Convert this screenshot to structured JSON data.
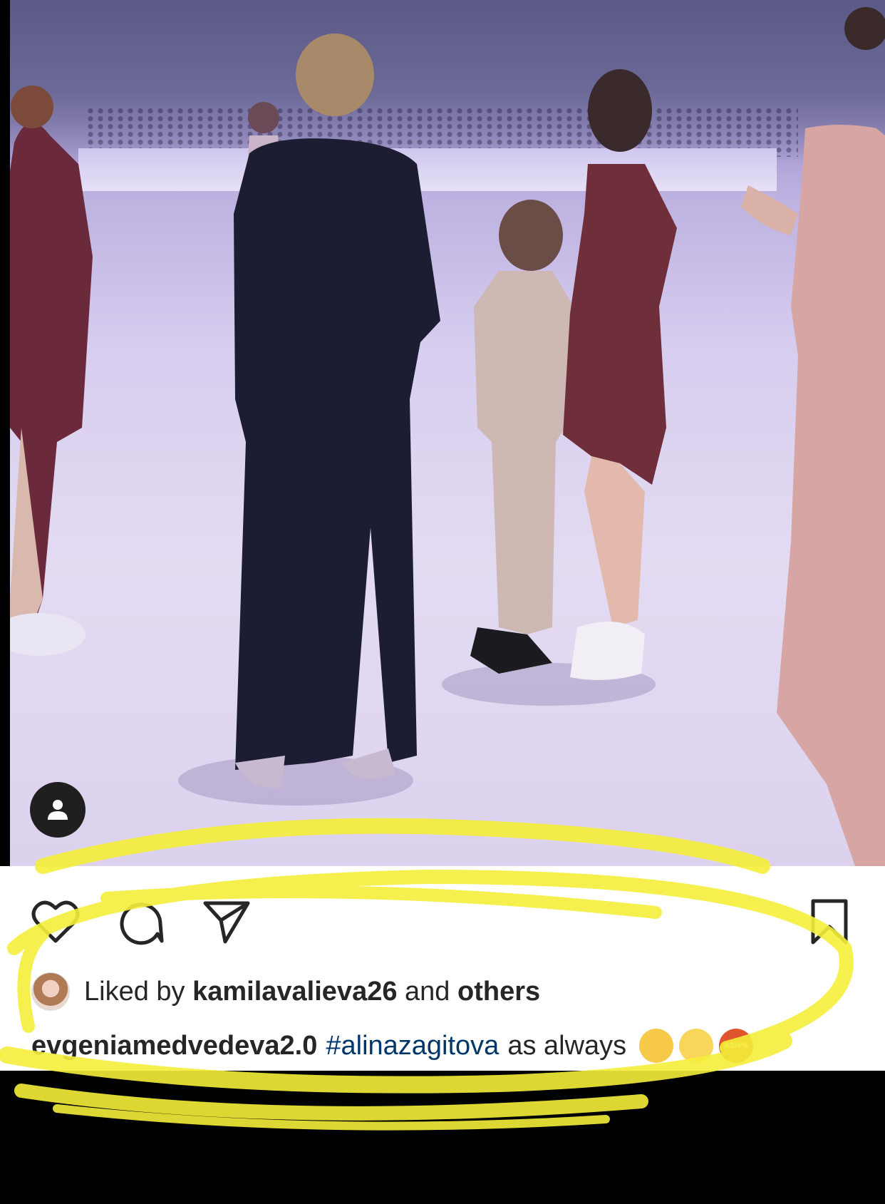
{
  "post": {
    "actions": {
      "like_icon": "heart-icon",
      "comment_icon": "comment-icon",
      "share_icon": "paper-plane-icon",
      "save_icon": "bookmark-icon"
    },
    "likes": {
      "prefix": "Liked by",
      "user": "kamilavalieva26",
      "joiner": "and",
      "others": "others"
    },
    "caption": {
      "username": "evgeniamedvedeva2.0",
      "hashtag": "#alinazagitova",
      "text": "as always",
      "emoji_3_text": "&$!#%"
    },
    "media": {
      "tag_people_icon": "person-icon"
    }
  },
  "colors": {
    "hashtag": "#00376b",
    "highlight": "#f5ef3a"
  }
}
